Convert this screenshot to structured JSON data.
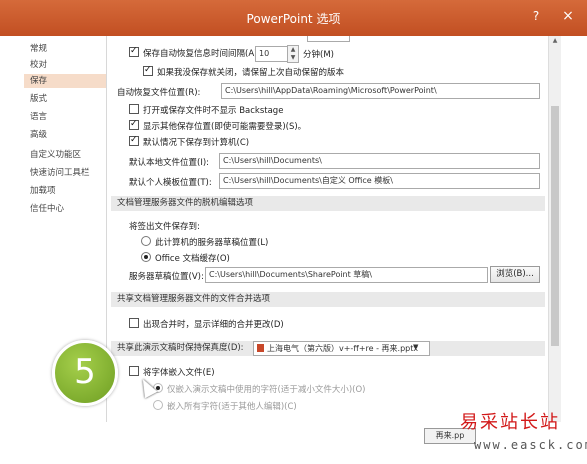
{
  "window": {
    "title": "PowerPoint 选项",
    "help_glyph": "?",
    "close_glyph": "×"
  },
  "sidebar": {
    "items": [
      {
        "label": "常规"
      },
      {
        "label": "校对"
      },
      {
        "label": "保存"
      },
      {
        "label": "版式"
      },
      {
        "label": "语言"
      },
      {
        "label": "高级"
      },
      {
        "label": "自定义功能区"
      },
      {
        "label": "快速访问工具栏"
      },
      {
        "label": "加载项"
      },
      {
        "label": "信任中心"
      }
    ],
    "active_index": 2
  },
  "save": {
    "autorecover_label": "保存自动恢复信息时间间隔(A)",
    "autorecover_minutes": "10",
    "minutes_unit": "分钟(M)",
    "keep_last_label": "如果我没保存就关闭，请保留上次自动保留的版本",
    "autorecover_location_label": "自动恢复文件位置(R):",
    "autorecover_location_value": "C:\\Users\\hill\\AppData\\Roaming\\Microsoft\\PowerPoint\\",
    "no_backstage_label": "打开或保存文件时不显示 Backstage",
    "show_other_locations_label": "显示其他保存位置(即使可能需要登录)(S)。",
    "save_to_computer_label": "默认情况下保存到计算机(C)",
    "default_local_label": "默认本地文件位置(I):",
    "default_local_value": "C:\\Users\\hill\\Documents\\",
    "personal_templates_label": "默认个人模板位置(T):",
    "personal_templates_value": "C:\\Users\\hill\\Documents\\自定义 Office 模板\\"
  },
  "offline": {
    "section_title": "文档管理服务器文件的脱机编辑选项",
    "save_checked_out_label": "将签出文件保存到:",
    "server_drafts_label": "此计算机的服务器草稿位置(L)",
    "office_cache_label": "Office 文档缓存(O)",
    "drafts_location_label": "服务器草稿位置(V):",
    "drafts_location_value": "C:\\Users\\hill\\Documents\\SharePoint 草稿\\",
    "browse_label": "浏览(B)..."
  },
  "merge": {
    "section_title": "共享文档管理服务器文件的文件合并选项",
    "show_merge_label": "出现合并时，显示详细的合并更改(D)"
  },
  "fidelity": {
    "label": "共享此演示文稿时保持保真度(D):",
    "document": "上海电气（第六版）v+-ff+re - 再来.pptx",
    "embed_fonts_label": "将字体嵌入文件(E)",
    "embed_used_label": "仅嵌入演示文稿中使用的字符(适于减小文件大小)(O)",
    "embed_all_label": "嵌入所有字符(适于其他人编辑)(C)"
  },
  "step_badge": "5",
  "footer": {
    "ok_label": "再来.pp"
  },
  "watermark": {
    "site": "易采站长站",
    "url": "www.easck.com"
  }
}
